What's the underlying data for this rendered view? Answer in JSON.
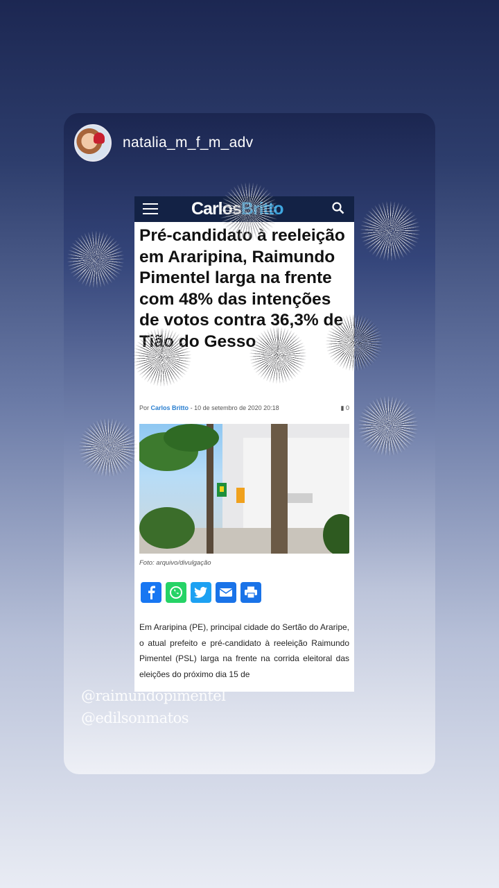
{
  "story": {
    "username": "natalia_m_f_m_adv",
    "mentions": [
      "@raimundopimentel",
      "@edilsonmatos"
    ]
  },
  "article": {
    "logo_part1": "Carlos",
    "logo_part2": "Britto",
    "title": "Pré-candidato à reeleição em Araripina, Raimundo Pimentel larga na frente com 48% das intenções de votos contra 36,3% de Tião do Gesso",
    "meta_prefix": "Por",
    "author": "Carlos Britto",
    "separator": "-",
    "date": "10 de setembro de 2020 20:18",
    "comment_count": "0",
    "caption": "Foto: arquivo/divulgação",
    "body": "Em Araripina (PE), principal cidade do Sertão do Araripe, o atual prefeito e pré-candidato à reeleição Raimundo Pimentel (PSL) larga na frente na corrida eleitoral das eleições do próximo dia 15 de"
  },
  "share_icons": [
    "facebook-icon",
    "whatsapp-icon",
    "twitter-icon",
    "email-icon",
    "print-icon"
  ],
  "colors": {
    "nav_bg": "#132245",
    "logo_accent": "#3fa7e0",
    "facebook": "#1877f2",
    "whatsapp": "#25d366",
    "twitter": "#1da1f2",
    "email": "#1a73e8",
    "print": "#1a73e8"
  }
}
